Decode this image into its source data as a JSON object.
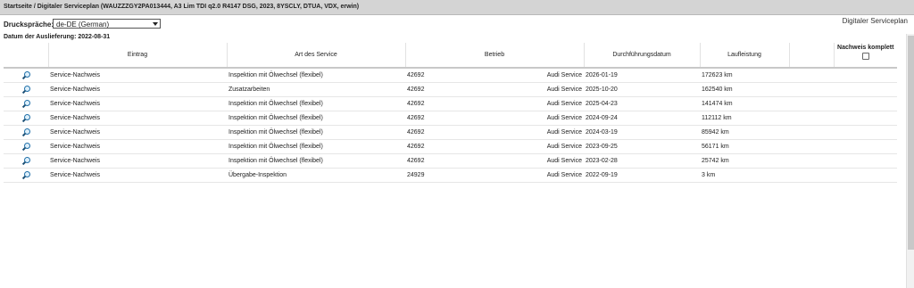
{
  "header": {
    "breadcrumb": "Startseite / Digitaler Serviceplan (WAUZZZGY2PA013444, A3 Lim TDI q2.0 R4147 DSG, 2023, 8YSCLY, DTUA, VDX, erwin)",
    "print_language_label": "Druckspräche:",
    "print_language_value": "de-DE (German)",
    "page_heading": "Digitaler Serviceplan",
    "delivery_date": "Datum der Auslieferung: 2022-08-31"
  },
  "table": {
    "columns": {
      "icon": "",
      "entry": "Eintrag",
      "service_type": "Art des Service",
      "workshop": "Betrieb",
      "date": "Durchführungsdatum",
      "mileage": "Laufleistung",
      "extra": "",
      "proof_complete": "Nachweis komplett"
    },
    "rows": [
      {
        "entry": "Service-Nachweis",
        "service_type": "Inspektion mit Ölwechsel (flexibel)",
        "workshop_id": "42692",
        "workshop_name": "Audi Service",
        "date": "2026-01-19",
        "mileage": "172623 km"
      },
      {
        "entry": "Service-Nachweis",
        "service_type": "Zusatzarbeiten",
        "workshop_id": "42692",
        "workshop_name": "Audi Service",
        "date": "2025-10-20",
        "mileage": "162540 km"
      },
      {
        "entry": "Service-Nachweis",
        "service_type": "Inspektion mit Ölwechsel (flexibel)",
        "workshop_id": "42692",
        "workshop_name": "Audi Service",
        "date": "2025-04-23",
        "mileage": "141474 km"
      },
      {
        "entry": "Service-Nachweis",
        "service_type": "Inspektion mit Ölwechsel (flexibel)",
        "workshop_id": "42692",
        "workshop_name": "Audi Service",
        "date": "2024-09-24",
        "mileage": "112112 km"
      },
      {
        "entry": "Service-Nachweis",
        "service_type": "Inspektion mit Ölwechsel (flexibel)",
        "workshop_id": "42692",
        "workshop_name": "Audi Service",
        "date": "2024-03-19",
        "mileage": "85942 km"
      },
      {
        "entry": "Service-Nachweis",
        "service_type": "Inspektion mit Ölwechsel (flexibel)",
        "workshop_id": "42692",
        "workshop_name": "Audi Service",
        "date": "2023-09-25",
        "mileage": "56171 km"
      },
      {
        "entry": "Service-Nachweis",
        "service_type": "Inspektion mit Ölwechsel (flexibel)",
        "workshop_id": "42692",
        "workshop_name": "Audi Service",
        "date": "2023-02-28",
        "mileage": "25742 km"
      },
      {
        "entry": "Service-Nachweis",
        "service_type": "Übergabe-Inspektion",
        "workshop_id": "24929",
        "workshop_name": "Audi Service",
        "date": "2022-09-19",
        "mileage": "3 km"
      }
    ],
    "row_icon": "magnifier-icon",
    "proof_checkbox_checked": false
  },
  "colors": {
    "breadcrumb_bar": "#d4d4d4",
    "icon_blue": "#1f6fa8"
  }
}
